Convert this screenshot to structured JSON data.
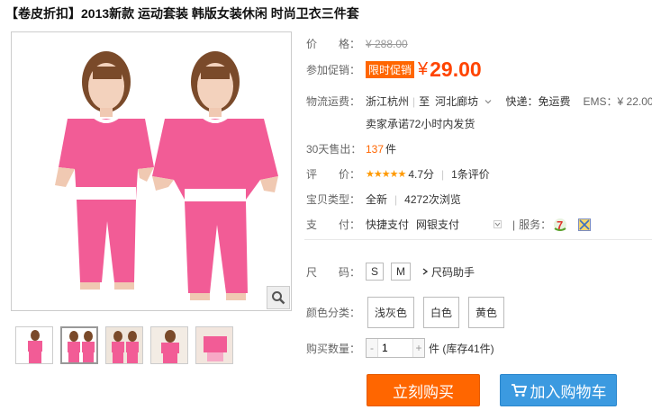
{
  "title": "【卷皮折扣】2013新款 运动套装 韩版女装休闲 时尚卫衣三件套",
  "price": {
    "label": "价　　格：",
    "original": "¥ 288.00"
  },
  "promo": {
    "label": "参加促销：",
    "tag": "限时促销",
    "symbol": "¥",
    "price": "29.00"
  },
  "shipping": {
    "label": "物流运费：",
    "from": "浙江杭州",
    "separator": "至",
    "to": "河北廊坊",
    "express": "快递：免运费",
    "ems": "EMS：¥ 22.00",
    "promise": "卖家承诺72小时内发货"
  },
  "sales": {
    "label": "30天售出：",
    "count": "137",
    "unit": "件"
  },
  "rating": {
    "label": "评　　价：",
    "stars": "★★★★★",
    "score": "4.7分",
    "reviews": "1条评价",
    "value": 4.7
  },
  "type": {
    "label": "宝贝类型：",
    "condition": "全新",
    "views": "4272次浏览"
  },
  "payment": {
    "label": "支　　付：",
    "method1": "快捷支付",
    "method2": "网银支付",
    "service_label": "服务："
  },
  "size": {
    "label": "尺　　码：",
    "options": [
      "S",
      "M"
    ],
    "helper": "尺码助手"
  },
  "color": {
    "label": "颜色分类：",
    "options": [
      "浅灰色",
      "白色",
      "黄色"
    ]
  },
  "quantity": {
    "label": "购买数量：",
    "minus": "-",
    "value": "1",
    "plus": "+",
    "stock": "件 (库存41件)"
  },
  "buttons": {
    "buy": "立刻购买",
    "cart": "加入购物车"
  },
  "colors": {
    "accent": "#ff6600",
    "price": "#ff4400",
    "cart": "#3b9ae0",
    "garment": "#f25c96"
  },
  "icons": {
    "zoom": "magnifier-icon",
    "cart": "cart-icon",
    "dropdown": "chevron-down-icon",
    "service1": "seven-day-return-icon",
    "service2": "guarantee-icon"
  }
}
